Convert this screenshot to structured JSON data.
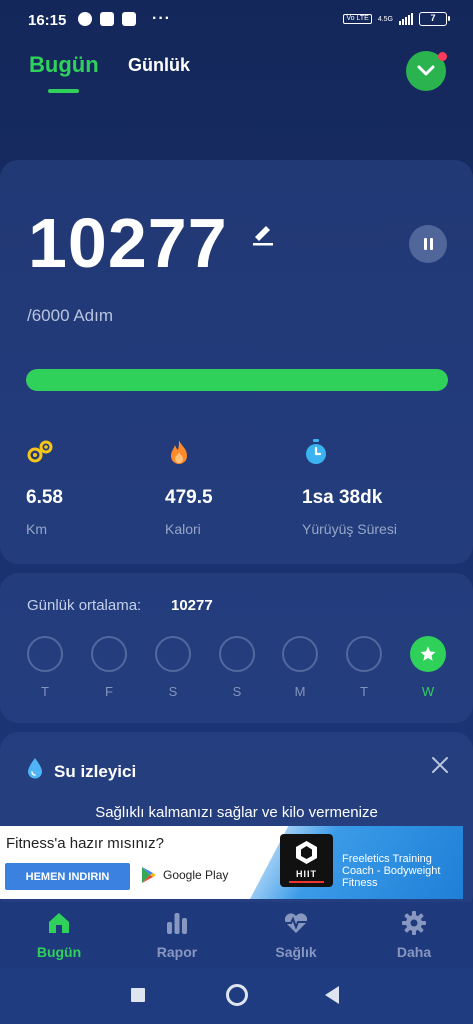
{
  "status_bar": {
    "time": "16:15",
    "network": "4.5G",
    "volte": "Vo LTE",
    "battery": "7"
  },
  "header": {
    "tabs": [
      {
        "label": "Bugün",
        "active": true
      },
      {
        "label": "Günlük",
        "active": false
      }
    ]
  },
  "steps": {
    "count": "10277",
    "goal_text": "/6000 Adım",
    "progress_fraction": 1.0
  },
  "stats": [
    {
      "icon": "footprint-distance-icon",
      "value": "6.58",
      "label": "Km",
      "color": "#f5c518"
    },
    {
      "icon": "flame-icon",
      "value": "479.5",
      "label": "Kalori",
      "color": "#ff8a2a"
    },
    {
      "icon": "stopwatch-icon",
      "value": "1sa 38dk",
      "label": "Yürüyüş Süresi",
      "color": "#3ab3f0"
    }
  ],
  "weekly": {
    "avg_label": "Günlük ortalama:",
    "avg_value": "10277",
    "days": [
      {
        "label": "T",
        "done": false
      },
      {
        "label": "F",
        "done": false
      },
      {
        "label": "S",
        "done": false
      },
      {
        "label": "S",
        "done": false
      },
      {
        "label": "M",
        "done": false
      },
      {
        "label": "T",
        "done": false
      },
      {
        "label": "W",
        "done": true
      }
    ]
  },
  "water": {
    "title": "Su izleyici",
    "text": "Sağlıklı kalmanızı sağlar ve kilo vermenize"
  },
  "ad": {
    "question": "Fitness'a hazır mısınız?",
    "cta": "HEMEN INDIRIN",
    "store": "Google Play",
    "logo_text": "HIIT",
    "app_name": "Freeletics Training Coach - Bodyweight Fitness"
  },
  "bottom_nav": [
    {
      "label": "Bugün",
      "icon": "home-icon",
      "active": true
    },
    {
      "label": "Rapor",
      "icon": "bar-chart-icon",
      "active": false
    },
    {
      "label": "Sağlık",
      "icon": "heartbeat-icon",
      "active": false
    },
    {
      "label": "Daha",
      "icon": "gear-icon",
      "active": false
    }
  ],
  "colors": {
    "accent": "#2fd15b",
    "background": "#1a3270",
    "card": "#2c4687"
  }
}
